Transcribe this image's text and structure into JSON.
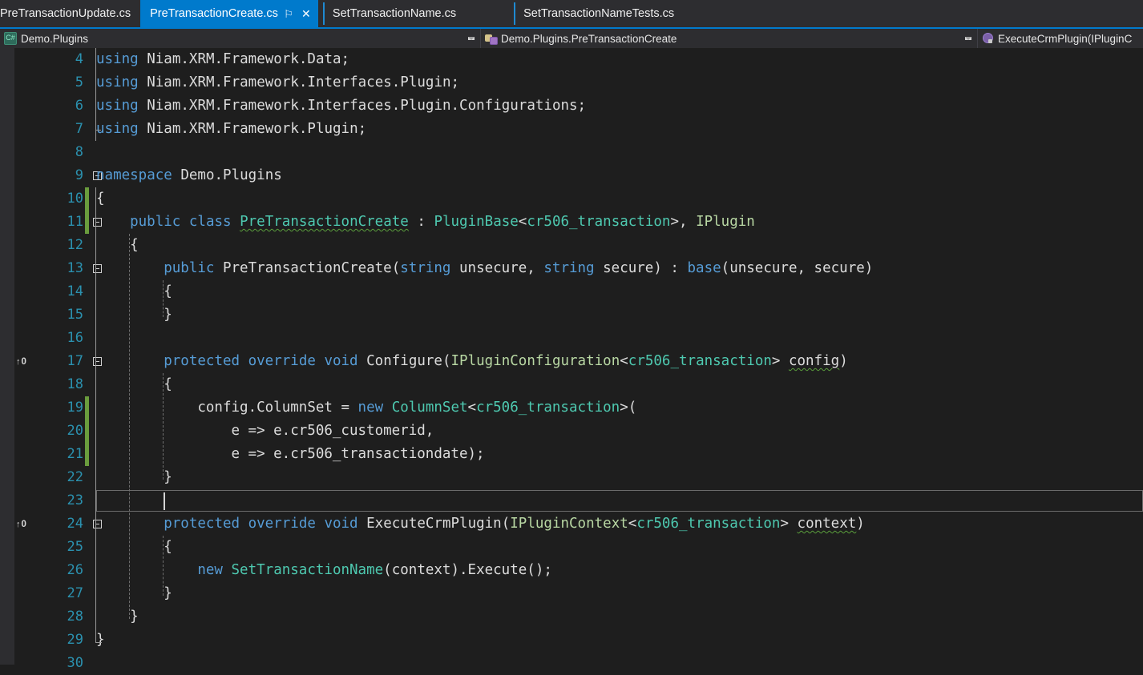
{
  "window": {
    "theme_bg": "#1e1e1e",
    "chrome_bg": "#2d2d30",
    "accent": "#007acc"
  },
  "tabs": [
    {
      "label": "PreTransactionUpdate.cs",
      "active": false
    },
    {
      "label": "PreTransactionCreate.cs",
      "active": true,
      "pin_icon": "⚐",
      "close_icon": "✕"
    },
    {
      "label": "SetTransactionName.cs",
      "active": false
    },
    {
      "label": "SetTransactionNameTests.cs",
      "active": false
    }
  ],
  "navbar": {
    "project": {
      "icon": "csharp-project-icon",
      "icon_glyph": "C#",
      "label": "Demo.Plugins"
    },
    "type": {
      "icon": "class-icon",
      "label": "Demo.Plugins.PreTransactionCreate"
    },
    "member": {
      "icon": "method-icon",
      "label": "ExecuteCrmPlugin(IPluginC"
    }
  },
  "editor": {
    "first_line": 4,
    "cursor_line": 23,
    "codelens_label": "0",
    "codelens_arrow": "↑",
    "lines": [
      {
        "n": 4,
        "codelens": null,
        "fold": false,
        "changed": false,
        "indent": 0,
        "tokens": [
          {
            "t": "using",
            "c": "kw"
          },
          {
            "t": " Niam.XRM.Framework.Data;",
            "c": "pln"
          }
        ]
      },
      {
        "n": 5,
        "codelens": null,
        "fold": false,
        "changed": false,
        "indent": 0,
        "tokens": [
          {
            "t": "using",
            "c": "kw"
          },
          {
            "t": " Niam.XRM.Framework.Interfaces.Plugin;",
            "c": "pln"
          }
        ]
      },
      {
        "n": 6,
        "codelens": null,
        "fold": false,
        "changed": false,
        "indent": 0,
        "tokens": [
          {
            "t": "using",
            "c": "kw"
          },
          {
            "t": " Niam.XRM.Framework.Interfaces.Plugin.Configurations;",
            "c": "pln"
          }
        ]
      },
      {
        "n": 7,
        "codelens": null,
        "fold": false,
        "changed": false,
        "indent": 0,
        "tokens": [
          {
            "t": "using",
            "c": "kw"
          },
          {
            "t": " Niam.XRM.Framework.Plugin;",
            "c": "pln"
          }
        ]
      },
      {
        "n": 8,
        "codelens": null,
        "fold": false,
        "changed": false,
        "indent": 0,
        "tokens": []
      },
      {
        "n": 9,
        "codelens": null,
        "fold": "minus",
        "changed": false,
        "indent": 0,
        "tokens": [
          {
            "t": "namespace",
            "c": "kw"
          },
          {
            "t": " Demo.Plugins",
            "c": "pln"
          }
        ]
      },
      {
        "n": 10,
        "codelens": null,
        "fold": false,
        "changed": true,
        "indent": 0,
        "tokens": [
          {
            "t": "{",
            "c": "pln"
          }
        ]
      },
      {
        "n": 11,
        "codelens": null,
        "fold": "minus",
        "changed": true,
        "indent": 1,
        "tokens": [
          {
            "t": "public",
            "c": "kw"
          },
          {
            "t": " ",
            "c": "pln"
          },
          {
            "t": "class",
            "c": "kw"
          },
          {
            "t": " ",
            "c": "pln"
          },
          {
            "t": "PreTransactionCreate",
            "c": "typ squig"
          },
          {
            "t": " : ",
            "c": "pln"
          },
          {
            "t": "PluginBase",
            "c": "typ"
          },
          {
            "t": "<",
            "c": "pln"
          },
          {
            "t": "cr506_transaction",
            "c": "typ"
          },
          {
            "t": ">, ",
            "c": "pln"
          },
          {
            "t": "IPlugin",
            "c": "ifc"
          }
        ]
      },
      {
        "n": 12,
        "codelens": null,
        "fold": false,
        "changed": false,
        "indent": 1,
        "tokens": [
          {
            "t": "{",
            "c": "pln"
          }
        ]
      },
      {
        "n": 13,
        "codelens": null,
        "fold": "minus",
        "changed": false,
        "indent": 2,
        "tokens": [
          {
            "t": "public",
            "c": "kw"
          },
          {
            "t": " PreTransactionCreate(",
            "c": "pln"
          },
          {
            "t": "string",
            "c": "kw"
          },
          {
            "t": " unsecure, ",
            "c": "pln"
          },
          {
            "t": "string",
            "c": "kw"
          },
          {
            "t": " secure) : ",
            "c": "pln"
          },
          {
            "t": "base",
            "c": "kw"
          },
          {
            "t": "(unsecure, secure)",
            "c": "pln"
          }
        ]
      },
      {
        "n": 14,
        "codelens": null,
        "fold": false,
        "changed": false,
        "indent": 2,
        "tokens": [
          {
            "t": "{",
            "c": "pln"
          }
        ]
      },
      {
        "n": 15,
        "codelens": null,
        "fold": false,
        "changed": false,
        "indent": 2,
        "tokens": [
          {
            "t": "}",
            "c": "pln"
          }
        ]
      },
      {
        "n": 16,
        "codelens": null,
        "fold": false,
        "changed": false,
        "indent": 0,
        "tokens": []
      },
      {
        "n": 17,
        "codelens": "0",
        "fold": "minus",
        "changed": false,
        "indent": 2,
        "tokens": [
          {
            "t": "protected",
            "c": "kw"
          },
          {
            "t": " ",
            "c": "pln"
          },
          {
            "t": "override",
            "c": "kw"
          },
          {
            "t": " ",
            "c": "pln"
          },
          {
            "t": "void",
            "c": "kw"
          },
          {
            "t": " Configure(",
            "c": "pln"
          },
          {
            "t": "IPluginConfiguration",
            "c": "ifc"
          },
          {
            "t": "<",
            "c": "pln"
          },
          {
            "t": "cr506_transaction",
            "c": "typ"
          },
          {
            "t": "> ",
            "c": "pln"
          },
          {
            "t": "config",
            "c": "pln squig"
          },
          {
            "t": ")",
            "c": "pln"
          }
        ]
      },
      {
        "n": 18,
        "codelens": null,
        "fold": false,
        "changed": false,
        "indent": 2,
        "tokens": [
          {
            "t": "{",
            "c": "pln"
          }
        ]
      },
      {
        "n": 19,
        "codelens": null,
        "fold": false,
        "changed": true,
        "indent": 3,
        "tokens": [
          {
            "t": "config.ColumnSet = ",
            "c": "pln"
          },
          {
            "t": "new",
            "c": "kw"
          },
          {
            "t": " ",
            "c": "pln"
          },
          {
            "t": "ColumnSet",
            "c": "typ"
          },
          {
            "t": "<",
            "c": "pln"
          },
          {
            "t": "cr506_transaction",
            "c": "typ"
          },
          {
            "t": ">(",
            "c": "pln"
          }
        ]
      },
      {
        "n": 20,
        "codelens": null,
        "fold": false,
        "changed": true,
        "indent": 4,
        "tokens": [
          {
            "t": "e => e.cr506_customerid,",
            "c": "pln"
          }
        ]
      },
      {
        "n": 21,
        "codelens": null,
        "fold": false,
        "changed": true,
        "indent": 4,
        "tokens": [
          {
            "t": "e => e.cr506_transactiondate);",
            "c": "pln"
          }
        ]
      },
      {
        "n": 22,
        "codelens": null,
        "fold": false,
        "changed": false,
        "indent": 2,
        "tokens": [
          {
            "t": "}",
            "c": "pln"
          }
        ]
      },
      {
        "n": 23,
        "codelens": null,
        "fold": false,
        "changed": false,
        "indent": 0,
        "tokens": []
      },
      {
        "n": 24,
        "codelens": "0",
        "fold": "minus",
        "changed": false,
        "indent": 2,
        "tokens": [
          {
            "t": "protected",
            "c": "kw"
          },
          {
            "t": " ",
            "c": "pln"
          },
          {
            "t": "override",
            "c": "kw"
          },
          {
            "t": " ",
            "c": "pln"
          },
          {
            "t": "void",
            "c": "kw"
          },
          {
            "t": " ExecuteCrmPlugin(",
            "c": "pln"
          },
          {
            "t": "IPluginContext",
            "c": "ifc"
          },
          {
            "t": "<",
            "c": "pln"
          },
          {
            "t": "cr506_transaction",
            "c": "typ"
          },
          {
            "t": "> ",
            "c": "pln"
          },
          {
            "t": "context",
            "c": "pln squig"
          },
          {
            "t": ")",
            "c": "pln"
          }
        ]
      },
      {
        "n": 25,
        "codelens": null,
        "fold": false,
        "changed": false,
        "indent": 2,
        "tokens": [
          {
            "t": "{",
            "c": "pln"
          }
        ]
      },
      {
        "n": 26,
        "codelens": null,
        "fold": false,
        "changed": false,
        "indent": 3,
        "tokens": [
          {
            "t": "new",
            "c": "kw"
          },
          {
            "t": " ",
            "c": "pln"
          },
          {
            "t": "SetTransactionName",
            "c": "typ"
          },
          {
            "t": "(context).Execute();",
            "c": "pln"
          }
        ]
      },
      {
        "n": 27,
        "codelens": null,
        "fold": false,
        "changed": false,
        "indent": 2,
        "tokens": [
          {
            "t": "}",
            "c": "pln"
          }
        ]
      },
      {
        "n": 28,
        "codelens": null,
        "fold": false,
        "changed": false,
        "indent": 1,
        "tokens": [
          {
            "t": "}",
            "c": "pln"
          }
        ]
      },
      {
        "n": 29,
        "codelens": null,
        "fold": false,
        "changed": false,
        "indent": 0,
        "tokens": [
          {
            "t": "}",
            "c": "pln"
          }
        ]
      },
      {
        "n": 30,
        "codelens": null,
        "fold": false,
        "changed": false,
        "indent": 0,
        "tokens": []
      }
    ]
  }
}
